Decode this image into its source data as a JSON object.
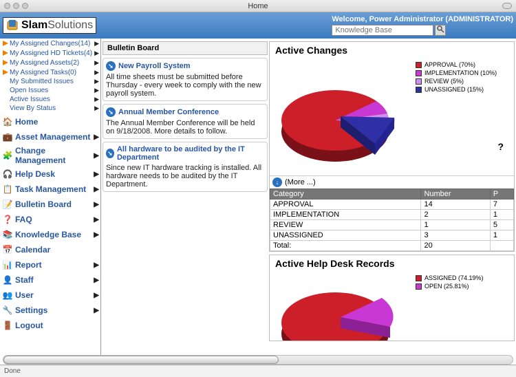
{
  "window_title": "Home",
  "logo": {
    "brand1": "Slam",
    "brand2": "Solutions"
  },
  "welcome": "Welcome, Power Administrator (ADMINISTRATOR)",
  "search_placeholder": "Knowledge Base",
  "my_list": [
    {
      "label": "My Assigned Changes(14)"
    },
    {
      "label": "My Assigned HD Tickets(4)"
    },
    {
      "label": "My Assigned Assets(2)"
    },
    {
      "label": "My Assigned Tasks(0)"
    },
    {
      "label": "My Submitted Issues"
    },
    {
      "label": "Open Issues"
    },
    {
      "label": "Active Issues"
    },
    {
      "label": "View By Status"
    }
  ],
  "nav": [
    {
      "label": "Home",
      "chev": false
    },
    {
      "label": "Asset Management",
      "chev": true
    },
    {
      "label": "Change Management",
      "chev": true
    },
    {
      "label": "Help Desk",
      "chev": true
    },
    {
      "label": "Task Management",
      "chev": true
    },
    {
      "label": "Bulletin Board",
      "chev": true
    },
    {
      "label": "FAQ",
      "chev": true
    },
    {
      "label": "Knowledge Base",
      "chev": true
    },
    {
      "label": "Calendar",
      "chev": false
    },
    {
      "label": "Report",
      "chev": true
    },
    {
      "label": "Staff",
      "chev": true
    },
    {
      "label": "User",
      "chev": true
    },
    {
      "label": "Settings",
      "chev": true
    },
    {
      "label": "Logout",
      "chev": false
    }
  ],
  "bulletin_title": "Bulletin Board",
  "bulletins": [
    {
      "title": "New Payroll System",
      "body": "All time sheets must be submitted before Thursday - every week to comply with the new payroll system."
    },
    {
      "title": "Annual Member Conference",
      "body": "The Annual Member Conference will be held on 9/18/2008. More details to follow."
    },
    {
      "title": "All hardware to be audited by the IT Department",
      "body": "Since new IT hardware tracking is installed. All hardware needs to be audited by the IT Department."
    }
  ],
  "chart1": {
    "title": "Active Changes",
    "legend": [
      {
        "label": "APPROVAL (70%)",
        "color": "#cc1f2a"
      },
      {
        "label": "IMPLEMENTATION (10%)",
        "color": "#c838d3"
      },
      {
        "label": "REVIEW (5%)",
        "color": "#cf8ef0"
      },
      {
        "label": "UNASSIGNED (15%)",
        "color": "#3030a6"
      }
    ],
    "more": "(More ...)",
    "table": {
      "headers": [
        "Category",
        "Number",
        "P"
      ],
      "rows": [
        [
          "APPROVAL",
          "14",
          "7"
        ],
        [
          "IMPLEMENTATION",
          "2",
          "1"
        ],
        [
          "REVIEW",
          "1",
          "5"
        ],
        [
          "UNASSIGNED",
          "3",
          "1"
        ],
        [
          "Total:",
          "20",
          ""
        ]
      ]
    }
  },
  "chart2": {
    "title": "Active Help Desk Records",
    "legend": [
      {
        "label": "ASSIGNED (74.19%)",
        "color": "#cc1f2a"
      },
      {
        "label": "OPEN (25.81%)",
        "color": "#c838d3"
      }
    ]
  },
  "status": "Done",
  "qmark": "?",
  "chart_data": [
    {
      "type": "pie",
      "title": "Active Changes",
      "categories": [
        "APPROVAL",
        "IMPLEMENTATION",
        "REVIEW",
        "UNASSIGNED"
      ],
      "values": [
        70,
        10,
        5,
        15
      ]
    },
    {
      "type": "pie",
      "title": "Active Help Desk Records",
      "categories": [
        "ASSIGNED",
        "OPEN"
      ],
      "values": [
        74.19,
        25.81
      ]
    }
  ]
}
